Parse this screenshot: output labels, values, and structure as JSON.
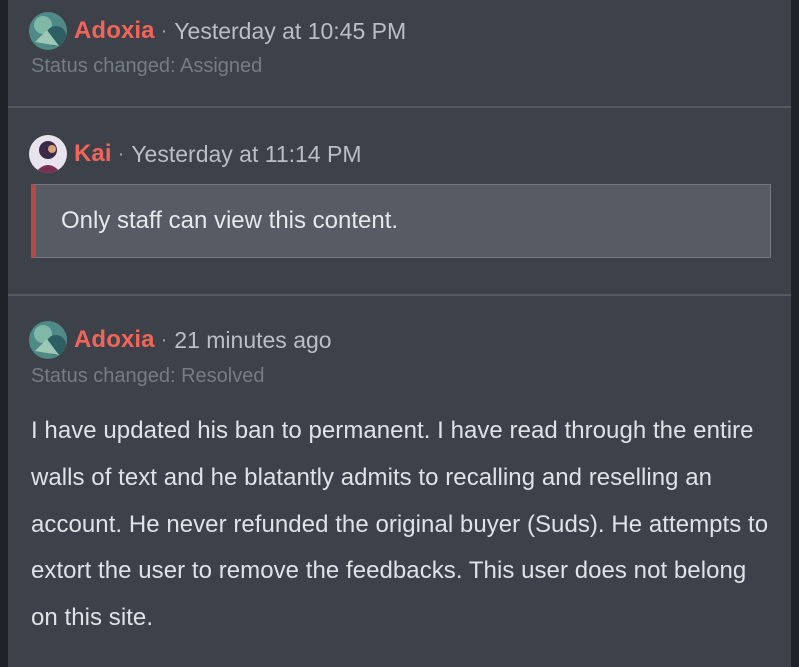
{
  "thread": {
    "entries": [
      {
        "user": "Adoxia",
        "separator": "·",
        "time": "Yesterday at 10:45 PM",
        "status": "Status changed: Assigned"
      },
      {
        "user": "Kai",
        "separator": "·",
        "time": "Yesterday at 11:14 PM",
        "staff_notice": "Only staff can view this content."
      },
      {
        "user": "Adoxia",
        "separator": "·",
        "time": "21 minutes ago",
        "status": "Status changed: Resolved",
        "message": "I have updated his ban to permanent. I have read through the entire walls of text and he blatantly admits to recalling and reselling an account. He never refunded the original buyer (Suds). He attempts to extort the user to remove the feedbacks. This user does not belong on this site."
      }
    ]
  },
  "colors": {
    "username": "#f2645a",
    "background": "#3d4149",
    "staff_accent": "#b24b47"
  }
}
